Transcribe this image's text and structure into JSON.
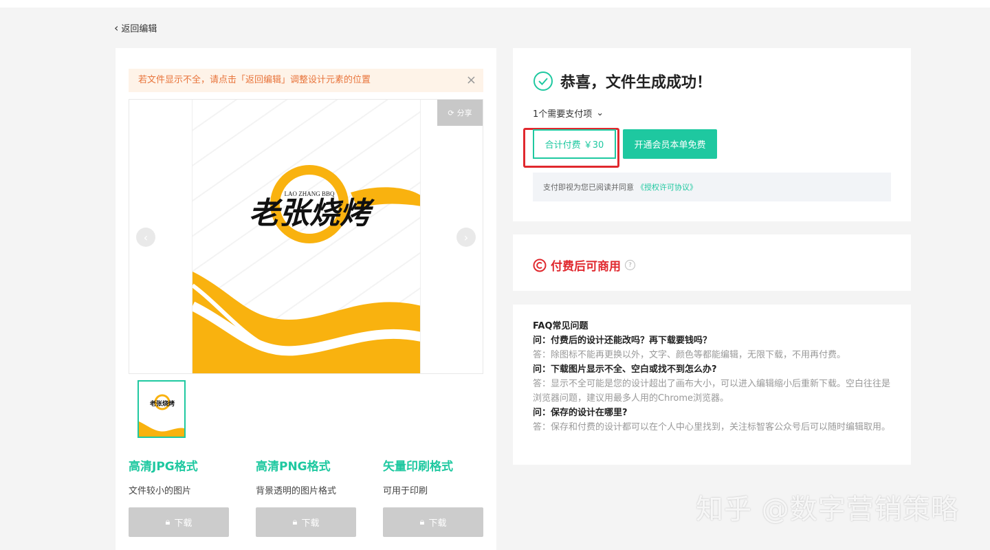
{
  "nav": {
    "back_label": "返回编辑"
  },
  "notice": {
    "text": "若文件显示不全，请点击「返回编辑」调整设计元素的位置"
  },
  "preview": {
    "share_label": "分享",
    "logo_text": "老张烧烤",
    "logo_subtitle": "LAO ZHANG BBQ",
    "accent_color": "#f9b20f"
  },
  "formats": [
    {
      "title": "高清JPG格式",
      "desc": "文件较小的图片",
      "button": "下载"
    },
    {
      "title": "高清PNG格式",
      "desc": "背景透明的图片格式",
      "button": "下载"
    },
    {
      "title": "矢量印刷格式",
      "desc": "可用于印刷",
      "button": "下载"
    }
  ],
  "success": {
    "title": "恭喜，文件生成成功！",
    "pay_items": "1个需要支付项",
    "total_label": "合计付费 ￥30",
    "vip_label": "开通会员本单免费",
    "agree_text": "支付即视为您已阅读并同意",
    "agree_link": "《授权许可协议》"
  },
  "commercial": {
    "label": "付费后可商用"
  },
  "faq": {
    "heading": "FAQ常见问题",
    "items": [
      {
        "q": "问：付费后的设计还能改吗？再下载要钱吗？",
        "a": "答：除图标不能再更换以外，文字、颜色等都能编辑，无限下载，不用再付费。"
      },
      {
        "q": "问：下载图片显示不全、空白或找不到怎么办?",
        "a": "答：显示不全可能是您的设计超出了画布大小，可以进入编辑缩小后重新下载。空白往往是浏览器问题，建议用最多人用的Chrome浏览器。"
      },
      {
        "q": "问：保存的设计在哪里?",
        "a": "答：保存和付费的设计都可以在个人中心里找到，关注标智客公众号后可以随时编辑取用。"
      }
    ]
  },
  "watermark": "知乎 @数字营销策略",
  "colors": {
    "brand": "#1ec8a0",
    "alert": "#e0282e",
    "notice": "#e8743b"
  }
}
